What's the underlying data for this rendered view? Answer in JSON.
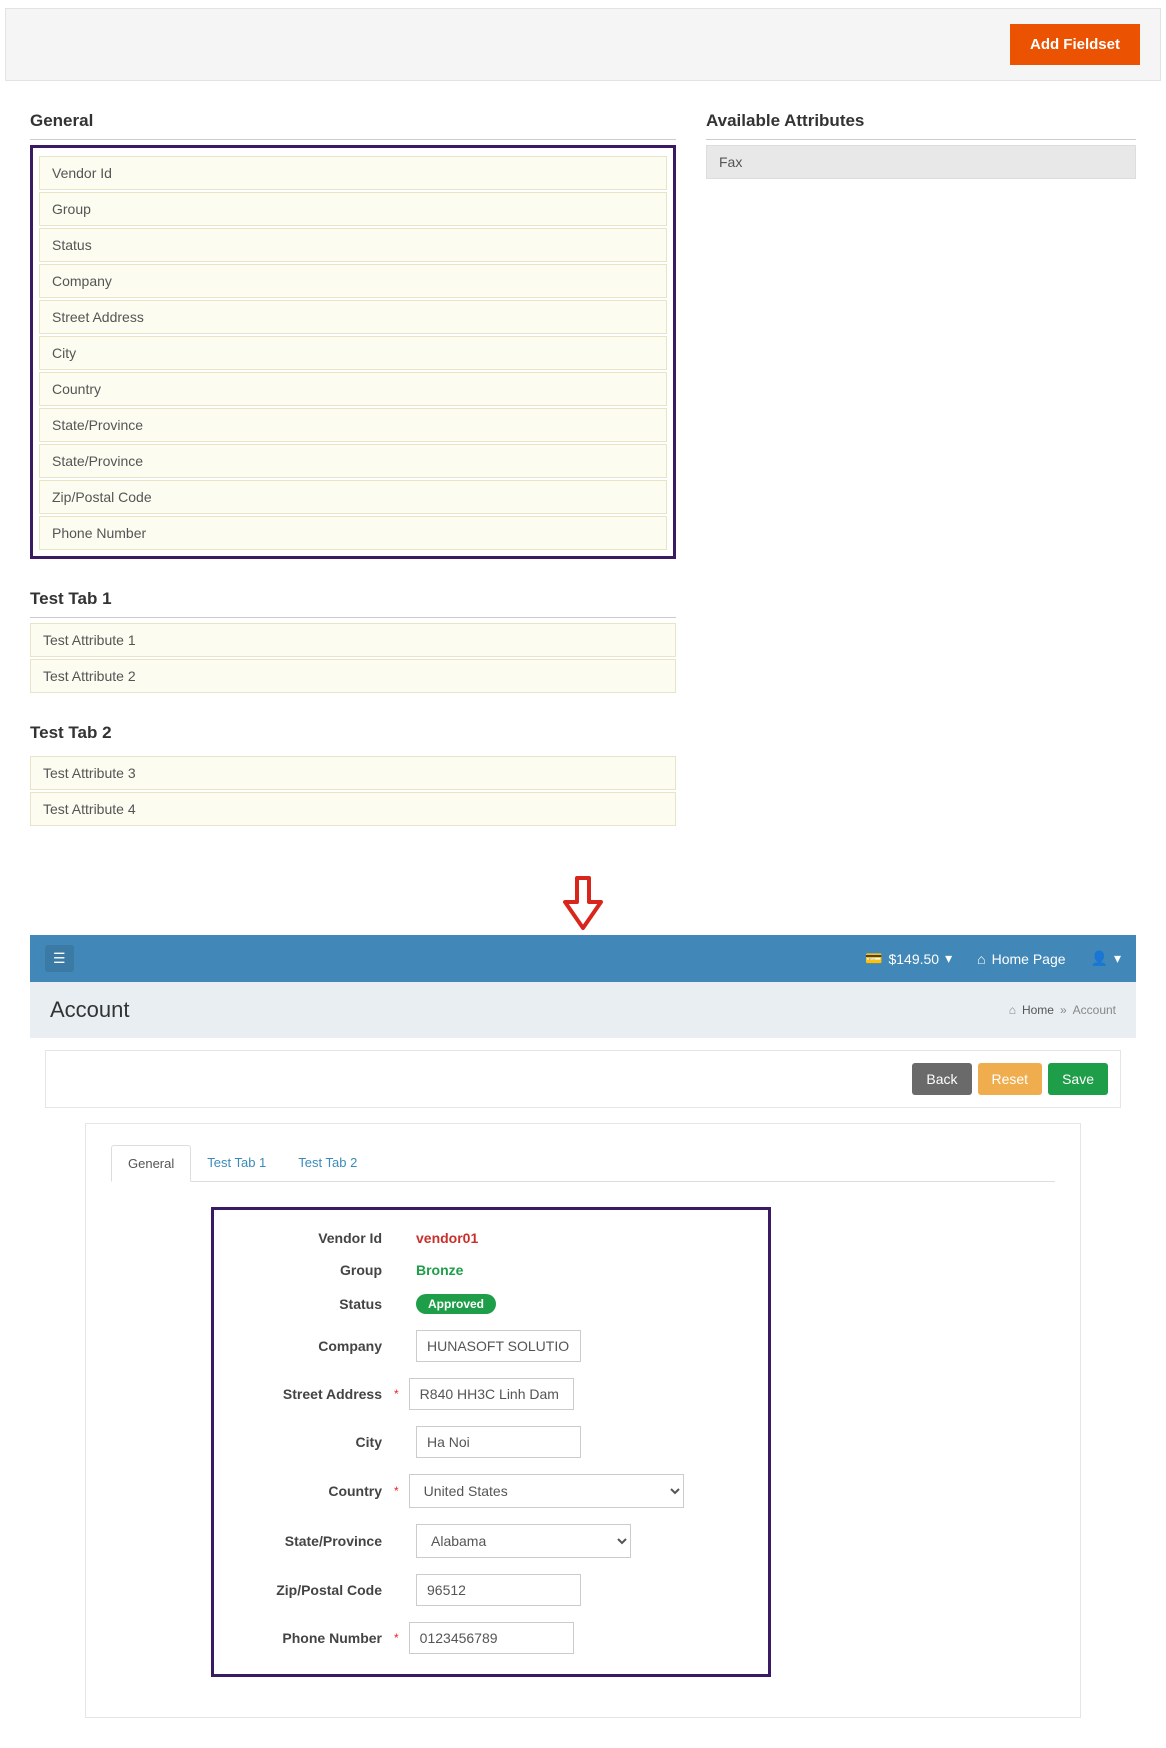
{
  "header": {
    "add_fieldset_label": "Add Fieldset"
  },
  "sections": {
    "general": {
      "title": "General",
      "items": [
        "Vendor Id",
        "Group",
        "Status",
        "Company",
        "Street Address",
        "City",
        "Country",
        "State/Province",
        "State/Province",
        "Zip/Postal Code",
        "Phone Number"
      ]
    },
    "test_tab_1": {
      "title": "Test Tab 1",
      "items": [
        "Test Attribute 1",
        "Test Attribute 2"
      ]
    },
    "test_tab_2": {
      "title": "Test Tab 2",
      "items": [
        "Test Attribute 3",
        "Test Attribute 4"
      ]
    }
  },
  "available": {
    "title": "Available Attributes",
    "items": [
      "Fax"
    ]
  },
  "app": {
    "balance": "$149.50",
    "home_page_label": "Home Page",
    "page_title": "Account",
    "breadcrumb": {
      "home": "Home",
      "current": "Account"
    },
    "buttons": {
      "back": "Back",
      "reset": "Reset",
      "save": "Save"
    },
    "tabs": [
      "General",
      "Test Tab 1",
      "Test Tab 2"
    ],
    "form": {
      "vendor_id": {
        "label": "Vendor Id",
        "value": "vendor01"
      },
      "group": {
        "label": "Group",
        "value": "Bronze"
      },
      "status": {
        "label": "Status",
        "value": "Approved"
      },
      "company": {
        "label": "Company",
        "value": "HUNASOFT SOLUTION C"
      },
      "street": {
        "label": "Street Address",
        "value": "R840 HH3C Linh Dam"
      },
      "city": {
        "label": "City",
        "value": "Ha Noi"
      },
      "country": {
        "label": "Country",
        "value": "United States"
      },
      "state": {
        "label": "State/Province",
        "value": "Alabama"
      },
      "zip": {
        "label": "Zip/Postal Code",
        "value": "96512"
      },
      "phone": {
        "label": "Phone Number",
        "value": "0123456789"
      }
    }
  }
}
